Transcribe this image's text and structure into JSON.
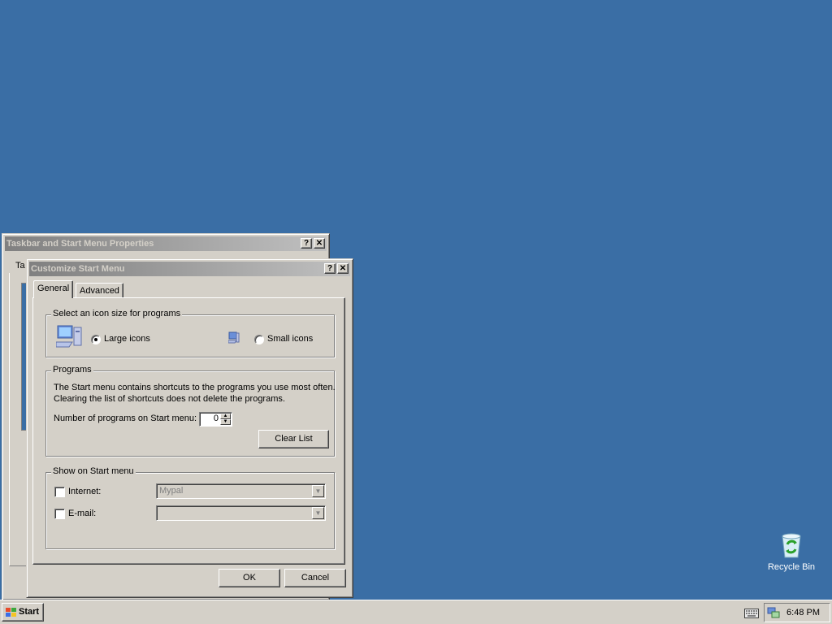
{
  "desktop": {
    "recycle_bin_label": "Recycle Bin"
  },
  "bg_window": {
    "title": "Taskbar and Start Menu Properties",
    "tab_fragment": "Ta"
  },
  "dialog": {
    "title": "Customize Start Menu",
    "help_button": "?",
    "close_button": "✕",
    "tabs": [
      {
        "label": "General",
        "active": true
      },
      {
        "label": "Advanced",
        "active": false
      }
    ],
    "icon_size_group": {
      "title": "Select an icon size for programs",
      "large_label": "Large icons",
      "small_label": "Small icons",
      "selected": "large"
    },
    "programs_group": {
      "title": "Programs",
      "description_line1": "The Start menu contains shortcuts to the programs you use most often.",
      "description_line2": "Clearing the list of shortcuts does not delete the programs.",
      "count_label": "Number of programs on Start menu:",
      "count_value": "0",
      "clear_button": "Clear List"
    },
    "show_group": {
      "title": "Show on Start menu",
      "internet_label": "Internet:",
      "internet_value": "Mypal",
      "internet_checked": false,
      "email_label": "E-mail:",
      "email_value": "",
      "email_checked": false
    },
    "ok_button": "OK",
    "cancel_button": "Cancel"
  },
  "taskbar": {
    "start_label": "Start",
    "clock": "6:48 PM"
  }
}
